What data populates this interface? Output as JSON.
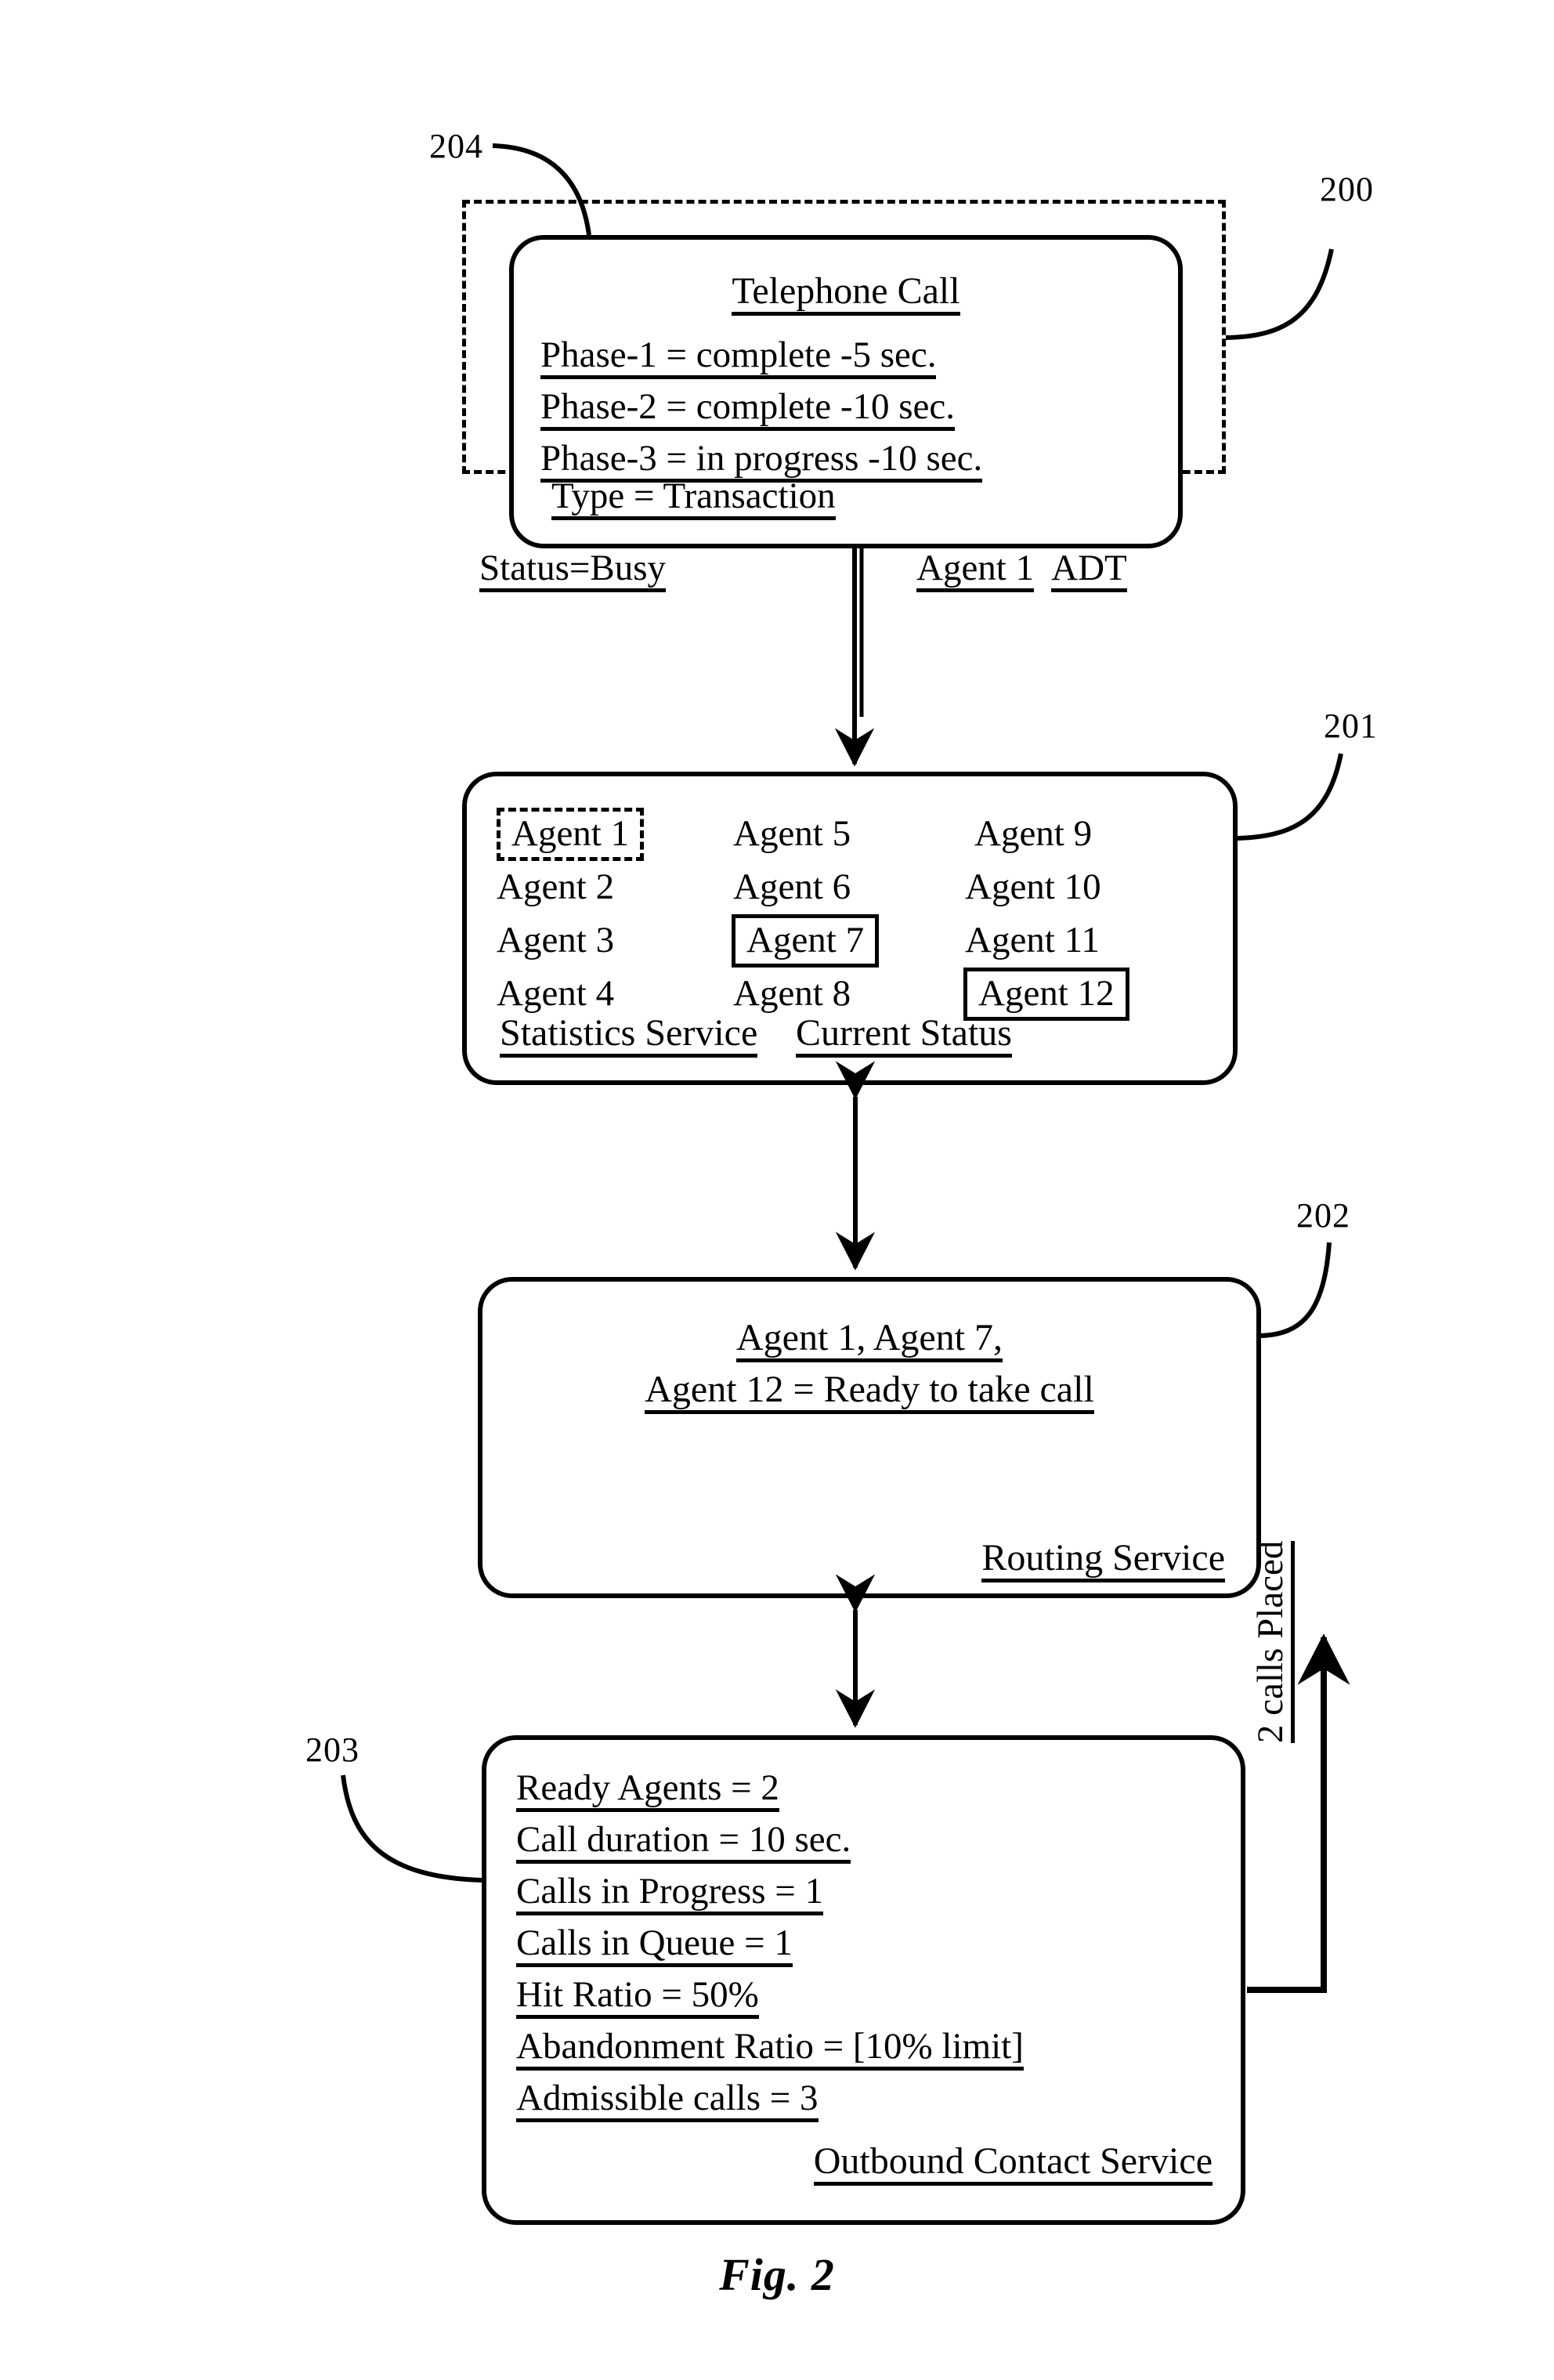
{
  "figure": {
    "caption": "Fig. 2"
  },
  "reference_numerals": {
    "n204": "204",
    "n200": "200",
    "n201": "201",
    "n202": "202",
    "n203": "203"
  },
  "telephone_call_box": {
    "title": "Telephone Call",
    "phases": [
      "Phase-1 = complete -5 sec.",
      "Phase-2 = complete -10 sec.",
      "Phase-3 = in progress -10 sec."
    ],
    "type_line": "Type = Transaction"
  },
  "status_bar": {
    "status": "Status=Busy",
    "agent": "Agent 1",
    "adt": "ADT"
  },
  "agents_box": {
    "columns": [
      [
        {
          "label": "Agent 1",
          "highlight": "dashed"
        },
        {
          "label": "Agent 2",
          "highlight": "none"
        },
        {
          "label": "Agent 3",
          "highlight": "none"
        },
        {
          "label": "Agent 4",
          "highlight": "none"
        }
      ],
      [
        {
          "label": "Agent 5",
          "highlight": "none"
        },
        {
          "label": "Agent 6",
          "highlight": "none"
        },
        {
          "label": "Agent 7",
          "highlight": "solid"
        },
        {
          "label": "Agent 8",
          "highlight": "none"
        }
      ],
      [
        {
          "label": "Agent 9",
          "highlight": "none"
        },
        {
          "label": "Agent 10",
          "highlight": "none"
        },
        {
          "label": "Agent 11",
          "highlight": "none"
        },
        {
          "label": "Agent 12",
          "highlight": "solid"
        }
      ]
    ],
    "footer_left": "Statistics Service",
    "footer_right": "Current Status"
  },
  "routing_box": {
    "line1": "Agent 1,  Agent 7,",
    "line2": "Agent 12 = Ready to take call",
    "footer": "Routing Service"
  },
  "outbound_box": {
    "lines": [
      "Ready Agents = 2",
      "Call duration = 10 sec.",
      "Calls in Progress = 1",
      "Calls in Queue = 1",
      "Hit Ratio = 50%",
      "Abandonment Ratio = [10% limit]",
      "Admissible calls = 3"
    ],
    "footer": "Outbound Contact Service"
  },
  "calls_placed_label": "2 calls Placed",
  "colors": {
    "ink": "#000000",
    "paper": "#ffffff"
  }
}
